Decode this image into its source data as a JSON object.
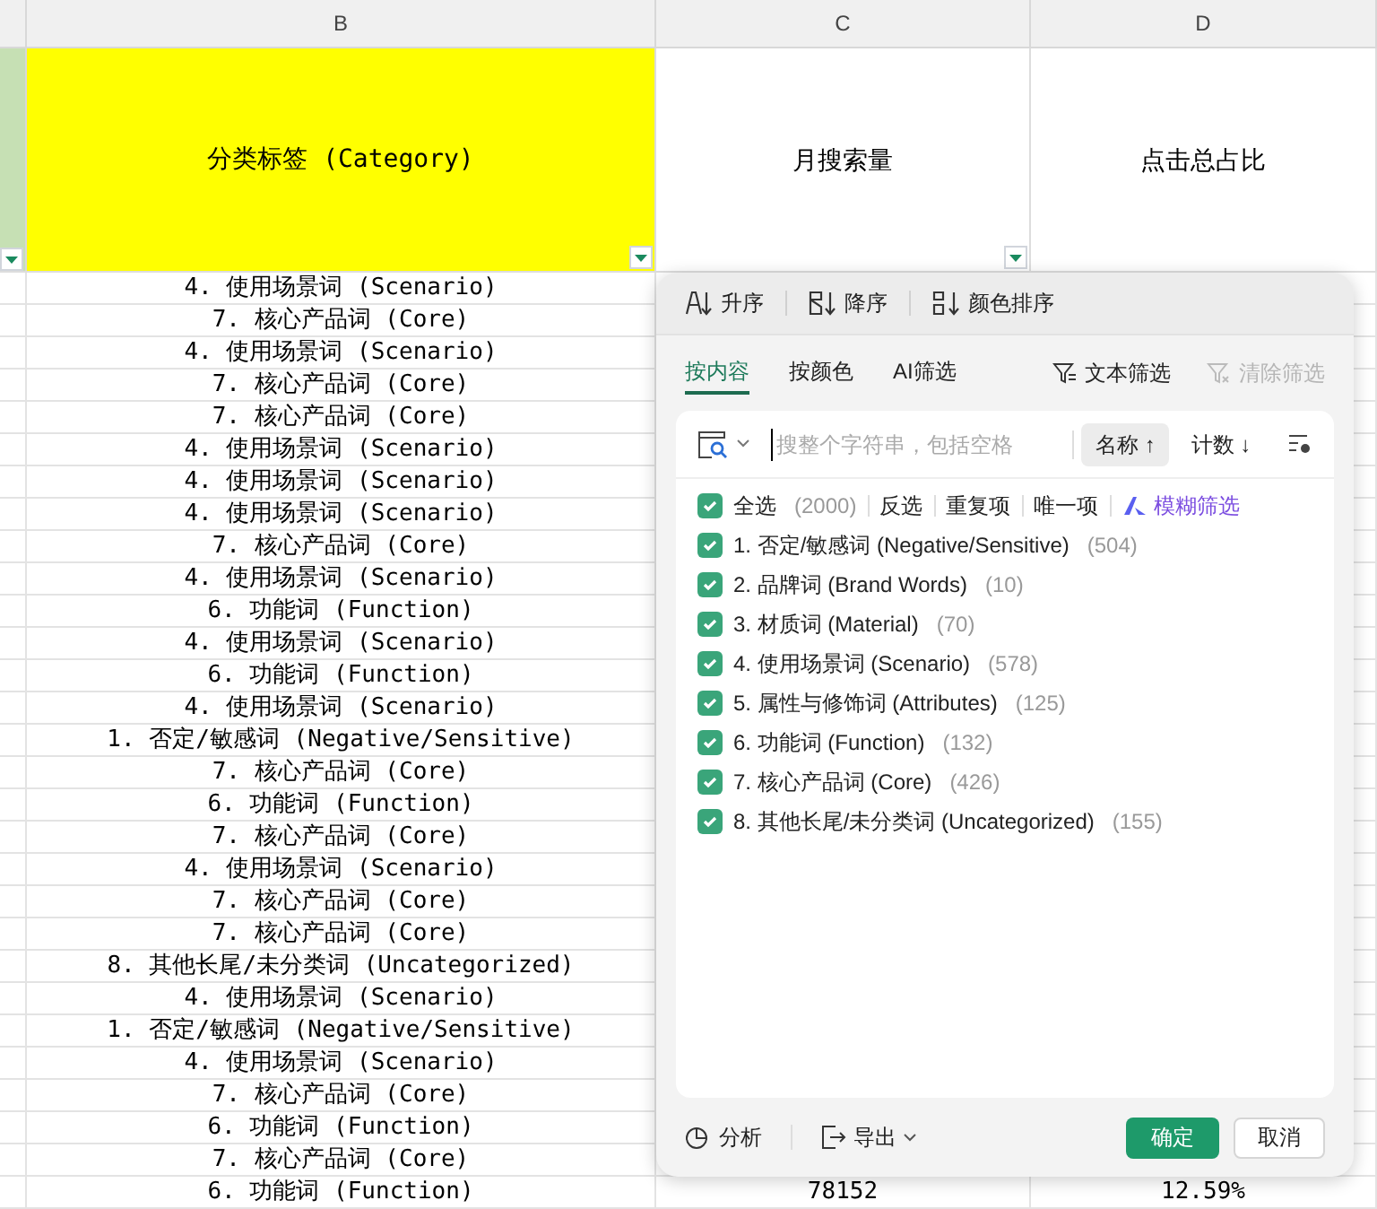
{
  "sheet": {
    "column_letters": [
      "B",
      "C",
      "D"
    ],
    "header_cells": [
      {
        "text": "分类标签 (Category)",
        "has_filter": true
      },
      {
        "text": "月搜索量",
        "has_filter": true
      },
      {
        "text": "点击总占比",
        "has_filter": false
      }
    ],
    "rows": [
      {
        "category": "4. 使用场景词 (Scenario)"
      },
      {
        "category": "7. 核心产品词 (Core)"
      },
      {
        "category": "4. 使用场景词 (Scenario)"
      },
      {
        "category": "7. 核心产品词 (Core)"
      },
      {
        "category": "7. 核心产品词 (Core)"
      },
      {
        "category": "4. 使用场景词 (Scenario)"
      },
      {
        "category": "4. 使用场景词 (Scenario)"
      },
      {
        "category": "4. 使用场景词 (Scenario)"
      },
      {
        "category": "7. 核心产品词 (Core)"
      },
      {
        "category": "4. 使用场景词 (Scenario)"
      },
      {
        "category": "6. 功能词 (Function)"
      },
      {
        "category": "4. 使用场景词 (Scenario)"
      },
      {
        "category": "6. 功能词 (Function)"
      },
      {
        "category": "4. 使用场景词 (Scenario)"
      },
      {
        "category": "1. 否定/敏感词 (Negative/Sensitive)"
      },
      {
        "category": "7. 核心产品词 (Core)"
      },
      {
        "category": "6. 功能词 (Function)"
      },
      {
        "category": "7. 核心产品词 (Core)"
      },
      {
        "category": "4. 使用场景词 (Scenario)"
      },
      {
        "category": "7. 核心产品词 (Core)"
      },
      {
        "category": "7. 核心产品词 (Core)"
      },
      {
        "category": "8. 其他长尾/未分类词 (Uncategorized)"
      },
      {
        "category": "4. 使用场景词 (Scenario)"
      },
      {
        "category": "1. 否定/敏感词 (Negative/Sensitive)"
      },
      {
        "category": "4. 使用场景词 (Scenario)"
      },
      {
        "category": "7. 核心产品词 (Core)"
      },
      {
        "category": "6. 功能词 (Function)"
      },
      {
        "category": "7. 核心产品词 (Core)"
      },
      {
        "category": "6. 功能词 (Function)",
        "column_c": "78152",
        "column_d": "12.59%"
      }
    ]
  },
  "filter_panel": {
    "sort_buttons": [
      {
        "kind": "ascending",
        "label": "升序"
      },
      {
        "kind": "descending",
        "label": "降序"
      },
      {
        "kind": "color",
        "label": "颜色排序"
      }
    ],
    "tabs": [
      {
        "label": "按内容",
        "selected": true
      },
      {
        "label": "按颜色",
        "selected": false
      },
      {
        "label": "AI筛选",
        "selected": false
      }
    ],
    "text_filter": "文本筛选",
    "clear_filter": {
      "label": "清除筛选",
      "disabled": true
    },
    "search": {
      "placeholder": "搜整个字符串，包括空格"
    },
    "sort_toggles": [
      {
        "label": "名称 ↑",
        "selected": true
      },
      {
        "label": "计数 ↓",
        "selected": false
      }
    ],
    "select_all": {
      "label": "全选",
      "count": "(2000)",
      "checked": true
    },
    "list_actions": [
      "反选",
      "重复项",
      "唯一项"
    ],
    "fuzzy_filter": "模糊筛选",
    "items": [
      {
        "label": "1. 否定/敏感词 (Negative/Sensitive)",
        "count": "(504)",
        "checked": true
      },
      {
        "label": "2. 品牌词 (Brand Words)",
        "count": "(10)",
        "checked": true
      },
      {
        "label": "3. 材质词 (Material)",
        "count": "(70)",
        "checked": true
      },
      {
        "label": "4. 使用场景词 (Scenario)",
        "count": "(578)",
        "checked": true
      },
      {
        "label": "5. 属性与修饰词 (Attributes)",
        "count": "(125)",
        "checked": true
      },
      {
        "label": "6. 功能词 (Function)",
        "count": "(132)",
        "checked": true
      },
      {
        "label": "7. 核心产品词 (Core)",
        "count": "(426)",
        "checked": true
      },
      {
        "label": "8. 其他长尾/未分类词 (Uncategorized)",
        "count": "(155)",
        "checked": true
      }
    ],
    "footer": {
      "analyze": "分析",
      "export": "导出",
      "confirm": "确定",
      "cancel": "取消"
    }
  }
}
